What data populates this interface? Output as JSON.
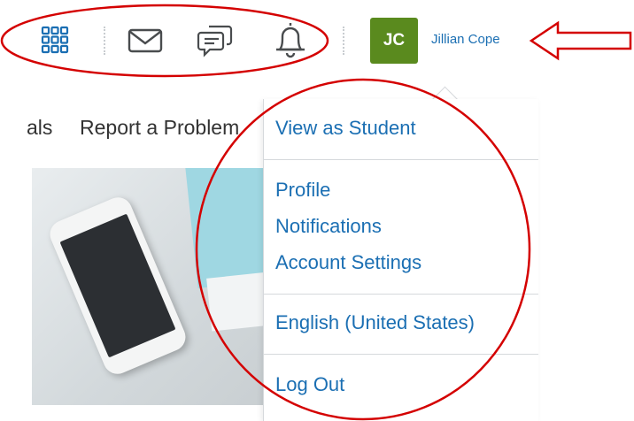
{
  "topbar": {
    "icons": [
      "apps-grid-icon",
      "mail-icon",
      "chat-icon",
      "bell-icon"
    ],
    "user": {
      "initials": "JC",
      "name": "Jillian Cope"
    }
  },
  "page": {
    "nav_items": [
      "als",
      "Report a Problem"
    ]
  },
  "dropdown": {
    "items": [
      "View as Student",
      "Profile",
      "Notifications",
      "Account Settings",
      "English (United States)",
      "Log Out"
    ]
  },
  "colors": {
    "link": "#1b6fb3",
    "avatar": "#5a8a1e",
    "annotation": "#d40000"
  }
}
